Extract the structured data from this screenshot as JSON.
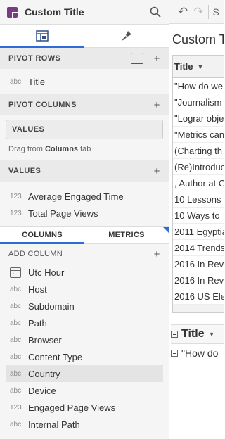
{
  "header": {
    "title": "Custom Title"
  },
  "pivot_rows": {
    "label": "PIVOT ROWS",
    "items": [
      {
        "type": "abc",
        "name": "Title"
      }
    ]
  },
  "pivot_columns": {
    "label": "PIVOT COLUMNS"
  },
  "values_box": {
    "label": "VALUES",
    "hint_prefix": "Drag from ",
    "hint_bold": "Columns",
    "hint_suffix": " tab"
  },
  "values": {
    "label": "VALUES",
    "items": [
      {
        "type": "123",
        "name": "Average Engaged Time"
      },
      {
        "type": "123",
        "name": "Total Page Views"
      }
    ]
  },
  "column_tabs": {
    "columns": "COLUMNS",
    "metrics": "METRICS"
  },
  "add_column": {
    "label": "ADD COLUMN"
  },
  "columns": [
    {
      "type": "date",
      "name": "Utc Hour"
    },
    {
      "type": "abc",
      "name": "Host"
    },
    {
      "type": "abc",
      "name": "Subdomain"
    },
    {
      "type": "abc",
      "name": "Path"
    },
    {
      "type": "abc",
      "name": "Browser"
    },
    {
      "type": "abc",
      "name": "Content Type"
    },
    {
      "type": "abc",
      "name": "Country"
    },
    {
      "type": "abc",
      "name": "Device"
    },
    {
      "type": "123",
      "name": "Engaged Page Views"
    },
    {
      "type": "abc",
      "name": "Internal Path"
    }
  ],
  "worksheet": {
    "title": "Custom T",
    "table_header": "Title",
    "rows": [
      "\"How do we",
      "\"Journalism",
      "\"Lograr obje",
      "\"Metrics can",
      "(Charting th",
      "(Re)Introduc",
      ", Author at C",
      "10 Lessons",
      "10 Ways to",
      "2011 Egyptia",
      "2014 Trends",
      "2016 In Rev",
      "2016 In Rev",
      "2016 US Ele"
    ],
    "pivot_header": "Title",
    "pivot_row": "\"How do"
  }
}
